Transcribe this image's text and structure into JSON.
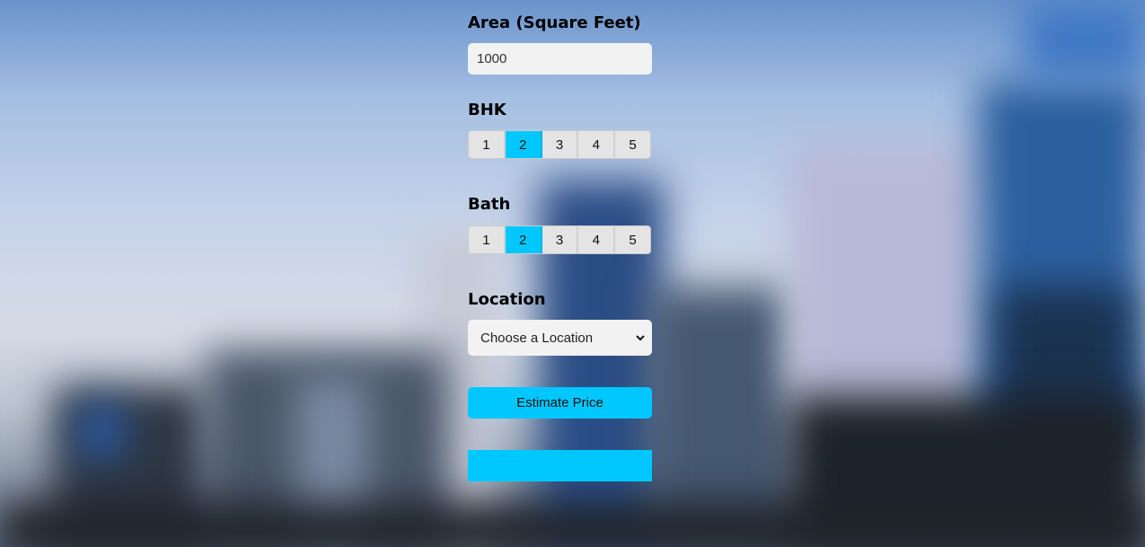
{
  "form": {
    "area": {
      "label": "Area (Square Feet)",
      "value": "1000"
    },
    "bhk": {
      "label": "BHK",
      "options": [
        "1",
        "2",
        "3",
        "4",
        "5"
      ],
      "selected": "2"
    },
    "bath": {
      "label": "Bath",
      "options": [
        "1",
        "2",
        "3",
        "4",
        "5"
      ],
      "selected": "2"
    },
    "location": {
      "label": "Location",
      "selected_text": "Choose a Location"
    },
    "estimate_button": {
      "label": "Estimate Price"
    },
    "result": {
      "text": ""
    }
  },
  "colors": {
    "accent": "#00c8ff",
    "input_bg": "#f2f2f2",
    "segment_bg": "#e4e4e4"
  },
  "icons": {
    "select_arrow": "chevron-down-icon"
  }
}
